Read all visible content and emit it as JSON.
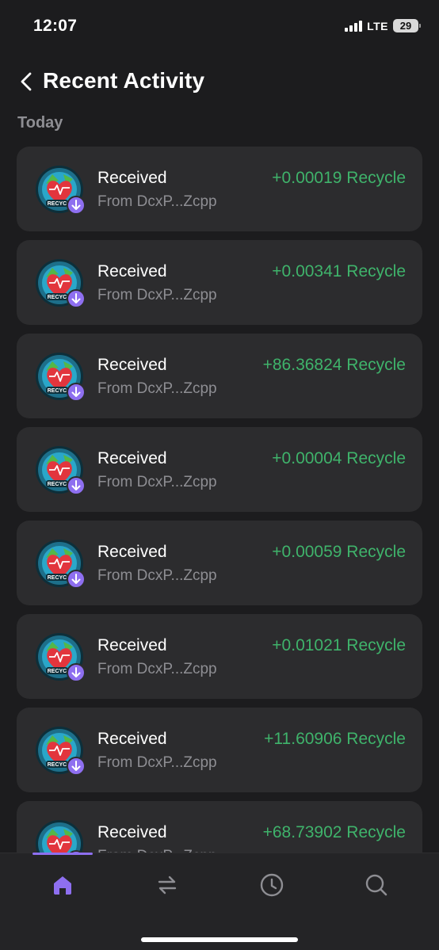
{
  "status_bar": {
    "time": "12:07",
    "network": "LTE",
    "battery": "29"
  },
  "header": {
    "title": "Recent Activity",
    "back_icon": "chevron-left-icon"
  },
  "section": {
    "label": "Today"
  },
  "activities": [
    {
      "title": "Received",
      "from": "From DcxP...Zcpp",
      "amount": "+0.00019 Recycle"
    },
    {
      "title": "Received",
      "from": "From DcxP...Zcpp",
      "amount": "+0.00341 Recycle"
    },
    {
      "title": "Received",
      "from": "From DcxP...Zcpp",
      "amount": "+86.36824 Recycle"
    },
    {
      "title": "Received",
      "from": "From DcxP...Zcpp",
      "amount": "+0.00004 Recycle"
    },
    {
      "title": "Received",
      "from": "From DcxP...Zcpp",
      "amount": "+0.00059 Recycle"
    },
    {
      "title": "Received",
      "from": "From DcxP...Zcpp",
      "amount": "+0.01021 Recycle"
    },
    {
      "title": "Received",
      "from": "From DcxP...Zcpp",
      "amount": "+11.60906 Recycle"
    },
    {
      "title": "Received",
      "from": "From DcxP...Zcpp",
      "amount": "+68.73902 Recycle"
    }
  ],
  "token_logo_text": "RECYC",
  "tabs": [
    {
      "name": "home",
      "icon": "home-icon",
      "active": true
    },
    {
      "name": "swap",
      "icon": "swap-icon",
      "active": false
    },
    {
      "name": "activity",
      "icon": "clock-icon",
      "active": false
    },
    {
      "name": "explore",
      "icon": "search-icon",
      "active": false
    }
  ],
  "colors": {
    "background": "#1c1c1e",
    "card": "#2c2c2e",
    "accent": "#8e6ff0",
    "positive": "#3fb36b",
    "secondary_text": "#8e8e93"
  }
}
